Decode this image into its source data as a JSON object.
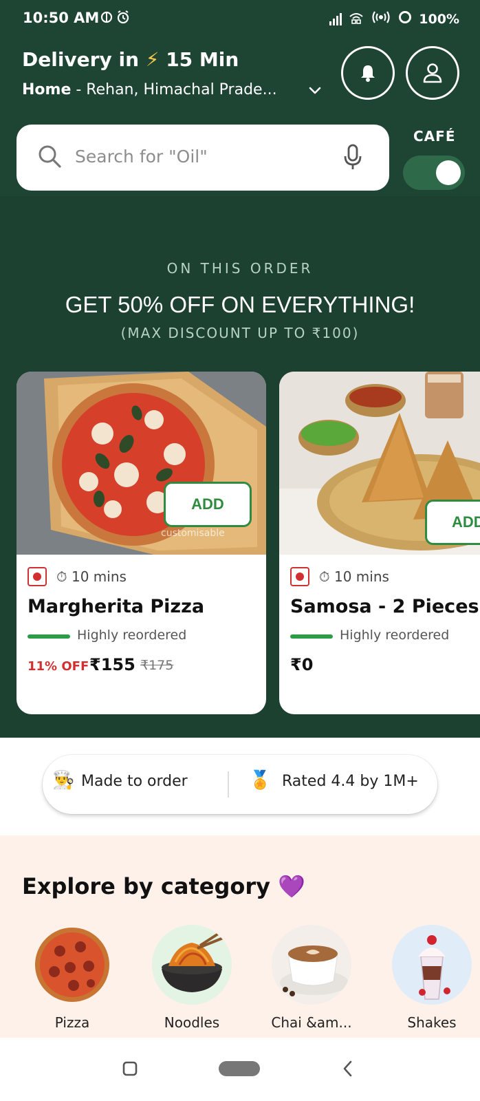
{
  "status_bar": {
    "time": "10:50 AM",
    "battery": "100%"
  },
  "header": {
    "delivery_prefix": "Delivery in",
    "delivery_time": "15 Min",
    "address_label": "Home",
    "address_text": " - Rehan, Himachal Prade..."
  },
  "search": {
    "placeholder": "Search for \"Oil\""
  },
  "cafe": {
    "label": "CAFÉ",
    "enabled": true
  },
  "banner": {
    "kicker": "ON THIS ORDER",
    "title": "GET 50% OFF ON EVERYTHING!",
    "subtitle": "(MAX DISCOUNT UP TO ₹100)"
  },
  "products": [
    {
      "name": "Margherita Pizza",
      "time": "10 mins",
      "tag": "Highly reordered",
      "discount": "11% OFF",
      "price": "₹155",
      "mrp": "₹175",
      "add_label": "ADD",
      "image_caption": "customisable"
    },
    {
      "name": "Samosa - 2 Pieces",
      "time": "10 mins",
      "tag": "Highly reordered",
      "price": "₹0",
      "add_label": "ADD"
    }
  ],
  "badges": {
    "made_to_order": "Made to order",
    "rating": "Rated 4.4 by 1M+"
  },
  "categories": {
    "title": "Explore by category",
    "items": [
      {
        "label": "Pizza"
      },
      {
        "label": "Noodles"
      },
      {
        "label": "Chai &am..."
      },
      {
        "label": "Shakes"
      }
    ]
  },
  "colors": {
    "header_green": "#1e4433",
    "accent_green": "#2e8b3f",
    "discount_red": "#d0302f",
    "category_bg": "#fdf1ea"
  }
}
